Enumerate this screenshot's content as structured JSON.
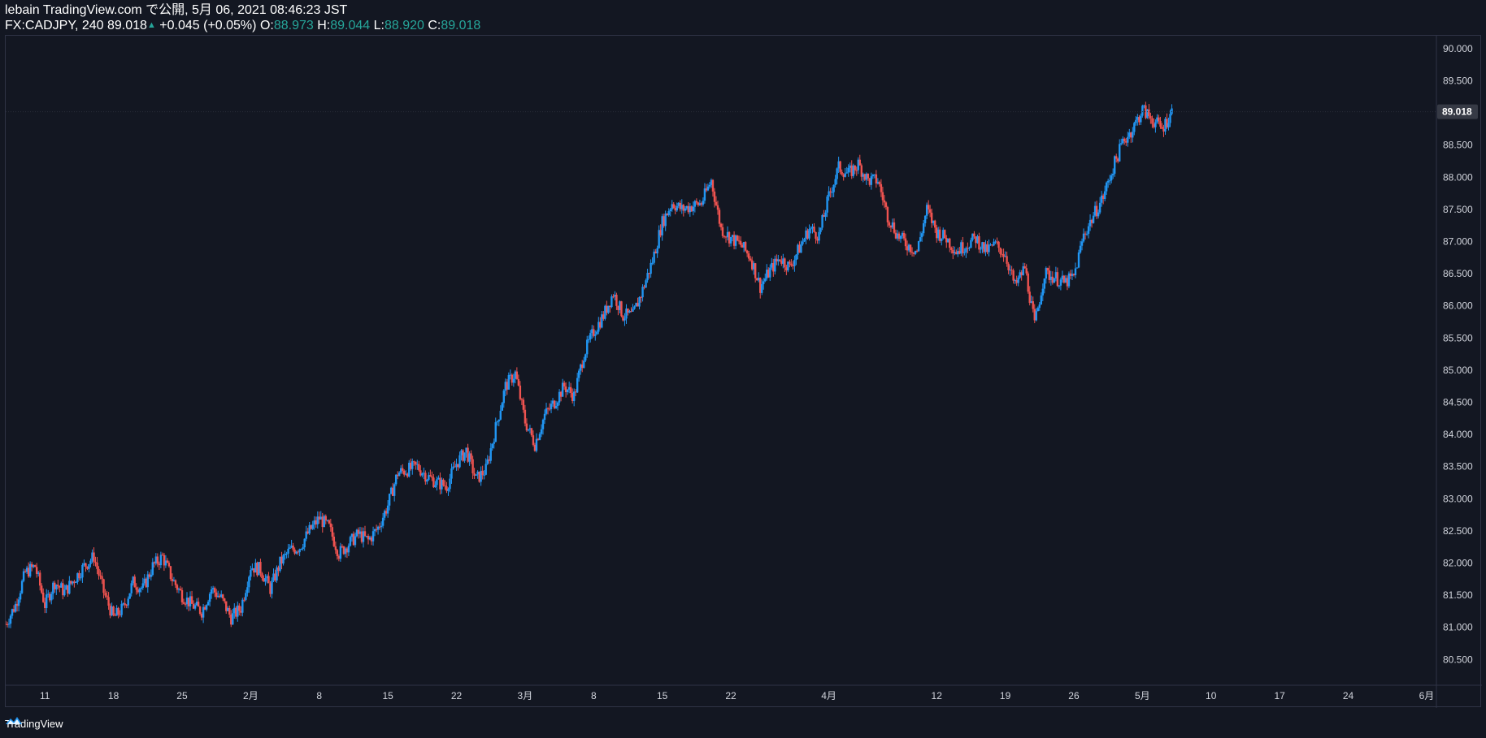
{
  "header": {
    "published_line": "lebain TradingView.com で公開, 5月 06, 2021 08:46:23 JST",
    "symbol": "FX:CADJPY, 240",
    "last_price": "89.018",
    "change": "+0.045 (+0.05%)",
    "open_label": "O:",
    "open_value": "88.973",
    "high_label": "H:",
    "high_value": "89.044",
    "low_label": "L:",
    "low_value": "88.920",
    "close_label": "C:",
    "close_value": "89.018"
  },
  "footer": {
    "brand": "TradingView"
  },
  "colors": {
    "background": "#131722",
    "up": "#2196f3",
    "down": "#ef5350",
    "axis_text": "#d1d4dc",
    "border": "#2f3346",
    "price_label_bg": "#363a45"
  },
  "chart_data": {
    "type": "candlestick",
    "symbol": "FX:CADJPY",
    "interval": "240",
    "price_axis": {
      "range": [
        80.1,
        90.2
      ],
      "ticks": [
        80.5,
        81.0,
        81.5,
        82.0,
        82.5,
        83.0,
        83.5,
        84.0,
        84.5,
        85.0,
        85.5,
        86.0,
        86.5,
        87.0,
        87.5,
        88.0,
        88.5,
        89.0,
        89.5,
        90.0
      ],
      "tick_labels": [
        "80.500",
        "81.000",
        "81.500",
        "82.000",
        "82.500",
        "83.000",
        "83.500",
        "84.000",
        "84.500",
        "85.000",
        "85.500",
        "86.000",
        "86.500",
        "87.000",
        "87.500",
        "88.000",
        "88.500",
        "89.000",
        "89.500",
        "90.000"
      ],
      "current_price": 89.018,
      "current_price_label": "89.018"
    },
    "time_axis": {
      "range": [
        "2021-01-07",
        "2021-06-02"
      ],
      "ticks": [
        {
          "date": "2021-01-11",
          "label": "11"
        },
        {
          "date": "2021-01-18",
          "label": "18"
        },
        {
          "date": "2021-01-25",
          "label": "25"
        },
        {
          "date": "2021-02-01",
          "label": "2月"
        },
        {
          "date": "2021-02-08",
          "label": "8"
        },
        {
          "date": "2021-02-15",
          "label": "15"
        },
        {
          "date": "2021-02-22",
          "label": "22"
        },
        {
          "date": "2021-03-01",
          "label": "3月"
        },
        {
          "date": "2021-03-08",
          "label": "8"
        },
        {
          "date": "2021-03-15",
          "label": "15"
        },
        {
          "date": "2021-03-22",
          "label": "22"
        },
        {
          "date": "2021-04-01",
          "label": "4月"
        },
        {
          "date": "2021-04-12",
          "label": "12"
        },
        {
          "date": "2021-04-19",
          "label": "19"
        },
        {
          "date": "2021-04-26",
          "label": "26"
        },
        {
          "date": "2021-05-03",
          "label": "5月"
        },
        {
          "date": "2021-05-10",
          "label": "10"
        },
        {
          "date": "2021-05-17",
          "label": "17"
        },
        {
          "date": "2021-05-24",
          "label": "24"
        },
        {
          "date": "2021-06-01",
          "label": "6月"
        }
      ]
    },
    "price_path": [
      [
        "2021-01-07",
        81.05
      ],
      [
        "2021-01-08",
        81.35
      ],
      [
        "2021-01-09",
        81.85
      ],
      [
        "2021-01-10",
        81.95
      ],
      [
        "2021-01-11",
        81.35
      ],
      [
        "2021-01-12",
        81.7
      ],
      [
        "2021-01-13",
        81.55
      ],
      [
        "2021-01-14",
        81.75
      ],
      [
        "2021-01-15",
        81.95
      ],
      [
        "2021-01-16",
        82.1
      ],
      [
        "2021-01-17",
        81.55
      ],
      [
        "2021-01-18",
        81.15
      ],
      [
        "2021-01-19",
        81.3
      ],
      [
        "2021-01-20",
        81.7
      ],
      [
        "2021-01-21",
        81.6
      ],
      [
        "2021-01-22",
        81.95
      ],
      [
        "2021-01-23",
        82.1
      ],
      [
        "2021-01-24",
        81.75
      ],
      [
        "2021-01-25",
        81.5
      ],
      [
        "2021-01-26",
        81.35
      ],
      [
        "2021-01-27",
        81.25
      ],
      [
        "2021-01-28",
        81.6
      ],
      [
        "2021-01-29",
        81.45
      ],
      [
        "2021-01-30",
        81.15
      ],
      [
        "2021-01-31",
        81.3
      ],
      [
        "2021-02-01",
        81.95
      ],
      [
        "2021-02-02",
        81.9
      ],
      [
        "2021-02-03",
        81.6
      ],
      [
        "2021-02-04",
        82.0
      ],
      [
        "2021-02-05",
        82.2
      ],
      [
        "2021-02-06",
        82.25
      ],
      [
        "2021-02-07",
        82.5
      ],
      [
        "2021-02-08",
        82.7
      ],
      [
        "2021-02-09",
        82.55
      ],
      [
        "2021-02-10",
        82.15
      ],
      [
        "2021-02-11",
        82.3
      ],
      [
        "2021-02-12",
        82.45
      ],
      [
        "2021-02-13",
        82.35
      ],
      [
        "2021-02-14",
        82.55
      ],
      [
        "2021-02-15",
        82.9
      ],
      [
        "2021-02-16",
        83.4
      ],
      [
        "2021-02-17",
        83.45
      ],
      [
        "2021-02-18",
        83.5
      ],
      [
        "2021-02-19",
        83.35
      ],
      [
        "2021-02-20",
        83.25
      ],
      [
        "2021-02-21",
        83.2
      ],
      [
        "2021-02-22",
        83.55
      ],
      [
        "2021-02-23",
        83.75
      ],
      [
        "2021-02-24",
        83.3
      ],
      [
        "2021-02-25",
        83.45
      ],
      [
        "2021-02-26",
        84.1
      ],
      [
        "2021-02-27",
        84.75
      ],
      [
        "2021-02-28",
        84.95
      ],
      [
        "2021-03-01",
        84.2
      ],
      [
        "2021-03-02",
        83.85
      ],
      [
        "2021-03-03",
        84.3
      ],
      [
        "2021-03-04",
        84.5
      ],
      [
        "2021-03-05",
        84.75
      ],
      [
        "2021-03-06",
        84.6
      ],
      [
        "2021-03-07",
        85.25
      ],
      [
        "2021-03-08",
        85.6
      ],
      [
        "2021-03-09",
        85.85
      ],
      [
        "2021-03-10",
        86.2
      ],
      [
        "2021-03-11",
        85.85
      ],
      [
        "2021-03-12",
        85.85
      ],
      [
        "2021-03-13",
        86.25
      ],
      [
        "2021-03-14",
        86.7
      ],
      [
        "2021-03-15",
        87.3
      ],
      [
        "2021-03-16",
        87.6
      ],
      [
        "2021-03-17",
        87.5
      ],
      [
        "2021-03-18",
        87.55
      ],
      [
        "2021-03-19",
        87.6
      ],
      [
        "2021-03-20",
        87.95
      ],
      [
        "2021-03-21",
        87.2
      ],
      [
        "2021-03-22",
        87.05
      ],
      [
        "2021-03-23",
        86.95
      ],
      [
        "2021-03-24",
        86.75
      ],
      [
        "2021-03-25",
        86.3
      ],
      [
        "2021-03-26",
        86.55
      ],
      [
        "2021-03-27",
        86.75
      ],
      [
        "2021-03-28",
        86.6
      ],
      [
        "2021-03-29",
        86.9
      ],
      [
        "2021-03-30",
        87.2
      ],
      [
        "2021-03-31",
        87.1
      ],
      [
        "2021-04-01",
        87.7
      ],
      [
        "2021-04-02",
        88.15
      ],
      [
        "2021-04-03",
        88.05
      ],
      [
        "2021-04-04",
        88.2
      ],
      [
        "2021-04-05",
        87.95
      ],
      [
        "2021-04-06",
        87.95
      ],
      [
        "2021-04-07",
        87.4
      ],
      [
        "2021-04-08",
        87.1
      ],
      [
        "2021-04-09",
        86.95
      ],
      [
        "2021-04-10",
        86.85
      ],
      [
        "2021-04-11",
        87.5
      ],
      [
        "2021-04-12",
        87.15
      ],
      [
        "2021-04-13",
        87.05
      ],
      [
        "2021-04-14",
        86.85
      ],
      [
        "2021-04-15",
        86.95
      ],
      [
        "2021-04-16",
        87.05
      ],
      [
        "2021-04-17",
        86.85
      ],
      [
        "2021-04-18",
        86.95
      ],
      [
        "2021-04-19",
        86.8
      ],
      [
        "2021-04-20",
        86.3
      ],
      [
        "2021-04-21",
        86.6
      ],
      [
        "2021-04-22",
        85.7
      ],
      [
        "2021-04-23",
        86.5
      ],
      [
        "2021-04-24",
        86.45
      ],
      [
        "2021-04-25",
        86.35
      ],
      [
        "2021-04-26",
        86.45
      ],
      [
        "2021-04-27",
        87.1
      ],
      [
        "2021-04-28",
        87.4
      ],
      [
        "2021-04-29",
        87.7
      ],
      [
        "2021-04-30",
        88.15
      ],
      [
        "2021-05-01",
        88.55
      ],
      [
        "2021-05-02",
        88.75
      ],
      [
        "2021-05-03",
        89.05
      ],
      [
        "2021-05-04",
        88.9
      ],
      [
        "2021-05-05",
        88.75
      ],
      [
        "2021-05-06",
        89.018
      ]
    ]
  }
}
